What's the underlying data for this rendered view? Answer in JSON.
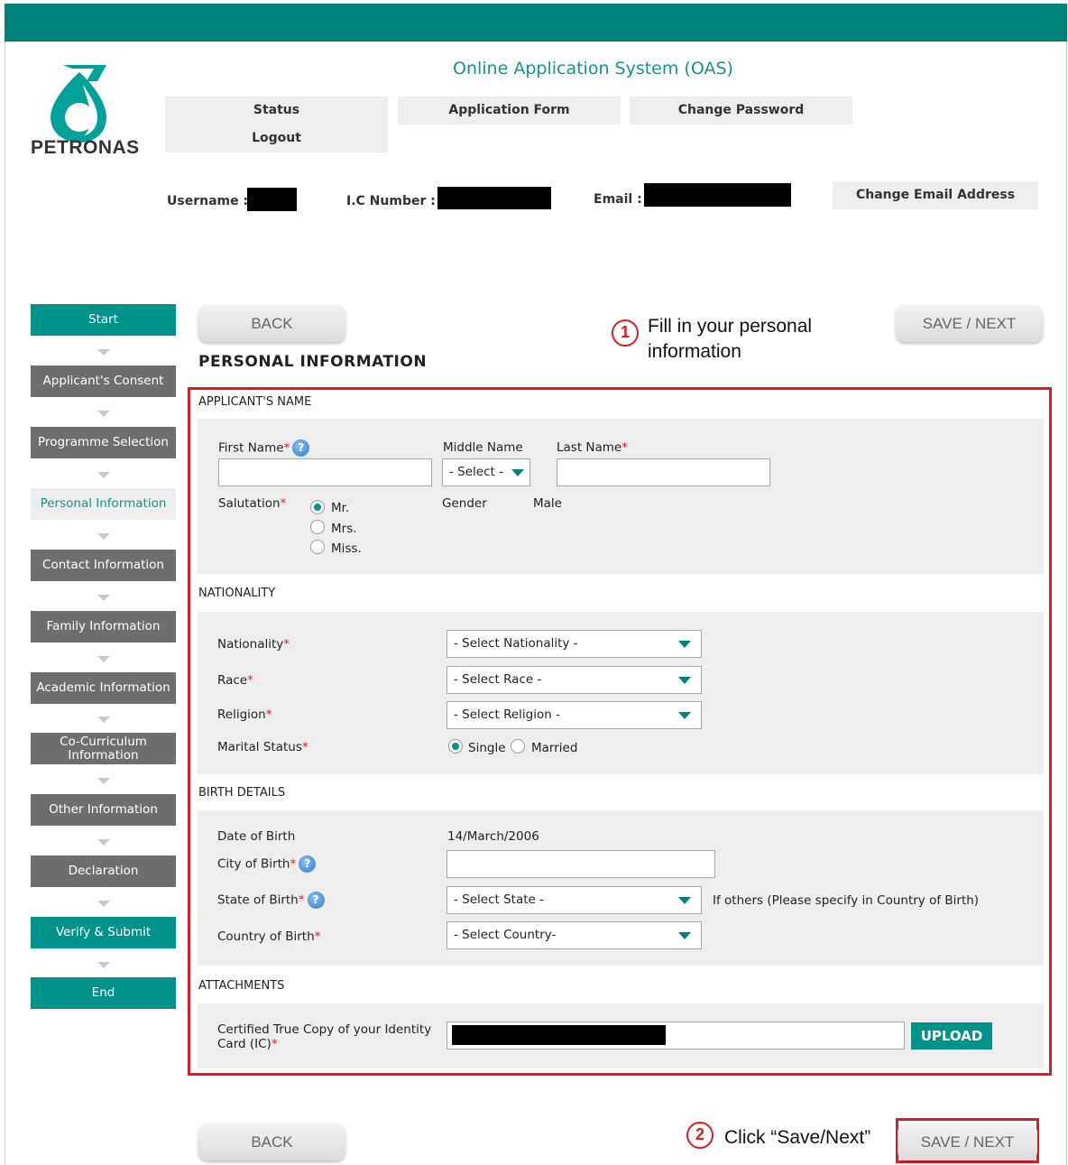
{
  "header": {
    "app_title": "Online Application System (OAS)",
    "logo_text": "PETRONAS",
    "nav": {
      "status": "Status",
      "logout": "Logout",
      "application_form": "Application Form",
      "change_password": "Change Password"
    },
    "username_label": "Username :",
    "ic_label": "I.C Number :",
    "email_label": "Email :",
    "change_email": "Change Email Address"
  },
  "toolbar": {
    "back": "BACK",
    "save_next": "SAVE / NEXT"
  },
  "annotations": {
    "one": {
      "num": "1",
      "text": "Fill in your personal information"
    },
    "two": {
      "num": "2",
      "text": "Click “Save/Next”"
    }
  },
  "steps": [
    "Start",
    "Applicant's Consent",
    "Programme Selection",
    "Personal Information",
    "Contact Information",
    "Family Information",
    "Academic Information",
    "Co-Curriculum Information",
    "Other Information",
    "Declaration",
    "Verify & Submit",
    "End"
  ],
  "page_title": "PERSONAL INFORMATION",
  "name_section": {
    "title": "APPLICANT'S NAME",
    "first_name": "First Name",
    "middle_name": "Middle Name",
    "middle_select": "- Select -",
    "last_name": "Last Name",
    "salutation": "Salutation",
    "salutation_options": [
      "Mr.",
      "Mrs.",
      "Miss."
    ],
    "gender_label": "Gender",
    "gender_value": "Male"
  },
  "nationality_section": {
    "title": "NATIONALITY",
    "nationality": "Nationality",
    "nationality_select": "- Select Nationality -",
    "race": "Race",
    "race_select": "- Select Race -",
    "religion": "Religion",
    "religion_select": "- Select Religion -",
    "marital": "Marital Status",
    "marital_options": [
      "Single",
      "Married"
    ]
  },
  "birth_section": {
    "title": "BIRTH DETAILS",
    "dob_label": "Date of Birth",
    "dob_value": "14/March/2006",
    "city": "City of Birth",
    "state": "State of Birth",
    "state_select": "- Select State -",
    "state_note": "If others (Please specify in Country of Birth)",
    "country": "Country of Birth",
    "country_select": "- Select Country-"
  },
  "attachments": {
    "title": "ATTACHMENTS",
    "ic_copy_1": "Certified True Copy of your Identity",
    "ic_copy_2": "Card (IC)",
    "upload": "UPLOAD"
  },
  "required_mark": "*",
  "help_glyph": "?"
}
